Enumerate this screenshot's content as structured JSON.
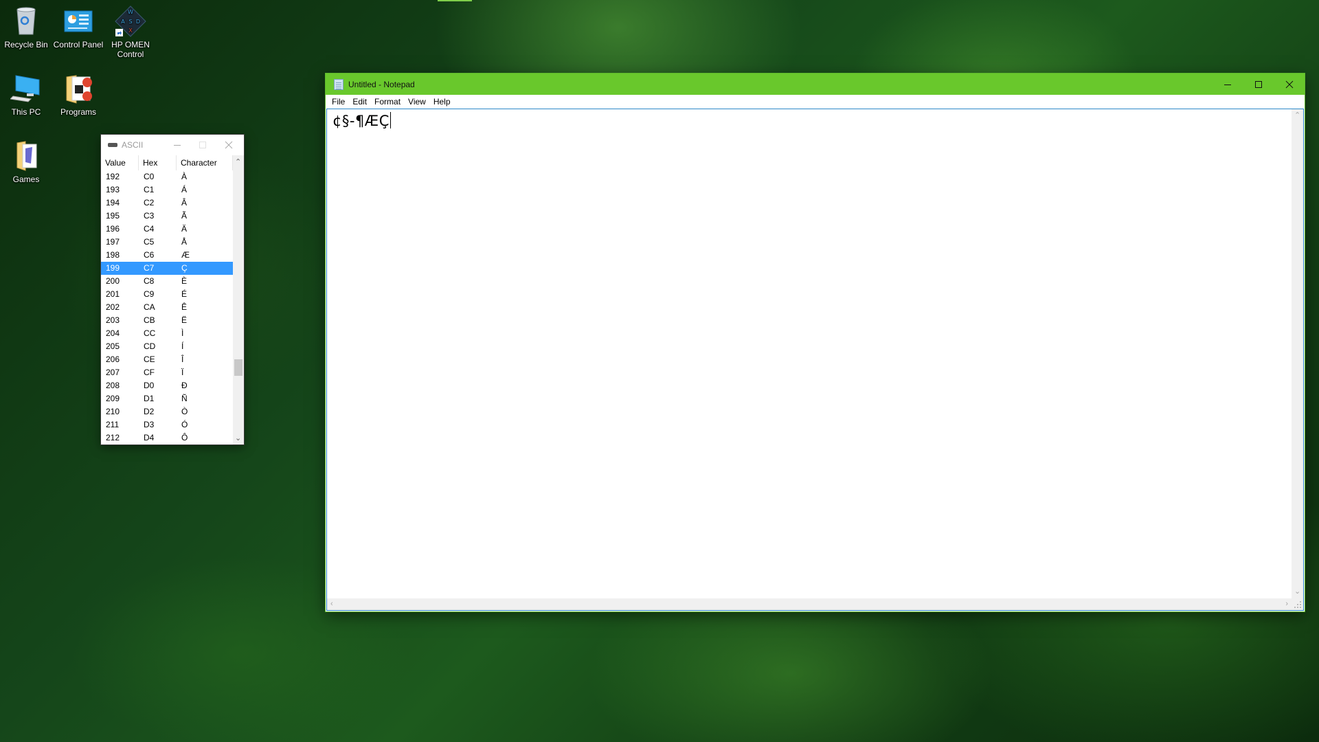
{
  "desktop": {
    "icons": [
      {
        "id": "recycle-bin",
        "label": "Recycle Bin"
      },
      {
        "id": "control-panel",
        "label": "Control Panel"
      },
      {
        "id": "hp-omen-control",
        "label": "HP OMEN Control",
        "label_line1": "HP OMEN",
        "label_line2": "Control"
      },
      {
        "id": "this-pc",
        "label": "This PC"
      },
      {
        "id": "programs",
        "label": "Programs"
      },
      {
        "id": "games",
        "label": "Games"
      }
    ],
    "omen_keys": [
      "W",
      "A",
      "S",
      "D",
      "X"
    ]
  },
  "notepad": {
    "title": "Untitled - Notepad",
    "menu": [
      "File",
      "Edit",
      "Format",
      "View",
      "Help"
    ],
    "content": "¢§-¶ÆÇ",
    "controls": {
      "minimize": "minimize",
      "maximize": "maximize",
      "close": "close"
    }
  },
  "ascii_window": {
    "title": "ASCII",
    "columns": [
      "Value",
      "Hex",
      "Character"
    ],
    "selected_value": "199",
    "scroll_position_fraction": 0.78,
    "rows": [
      {
        "value": "192",
        "hex": "C0",
        "char": "À"
      },
      {
        "value": "193",
        "hex": "C1",
        "char": "Á"
      },
      {
        "value": "194",
        "hex": "C2",
        "char": "Â"
      },
      {
        "value": "195",
        "hex": "C3",
        "char": "Ã"
      },
      {
        "value": "196",
        "hex": "C4",
        "char": "Ä"
      },
      {
        "value": "197",
        "hex": "C5",
        "char": "Å"
      },
      {
        "value": "198",
        "hex": "C6",
        "char": "Æ"
      },
      {
        "value": "199",
        "hex": "C7",
        "char": "Ç"
      },
      {
        "value": "200",
        "hex": "C8",
        "char": "È"
      },
      {
        "value": "201",
        "hex": "C9",
        "char": "É"
      },
      {
        "value": "202",
        "hex": "CA",
        "char": "Ê"
      },
      {
        "value": "203",
        "hex": "CB",
        "char": "Ë"
      },
      {
        "value": "204",
        "hex": "CC",
        "char": "Ì"
      },
      {
        "value": "205",
        "hex": "CD",
        "char": "Í"
      },
      {
        "value": "206",
        "hex": "CE",
        "char": "Î"
      },
      {
        "value": "207",
        "hex": "CF",
        "char": "Ï"
      },
      {
        "value": "208",
        "hex": "D0",
        "char": "Ð"
      },
      {
        "value": "209",
        "hex": "D1",
        "char": "Ñ"
      },
      {
        "value": "210",
        "hex": "D2",
        "char": "Ò"
      },
      {
        "value": "211",
        "hex": "D3",
        "char": "Ó"
      },
      {
        "value": "212",
        "hex": "D4",
        "char": "Ô"
      }
    ]
  },
  "colors": {
    "notepad_titlebar": "#69c82c",
    "selection": "#3399ff",
    "edit_focus_border": "#2e89c9"
  }
}
